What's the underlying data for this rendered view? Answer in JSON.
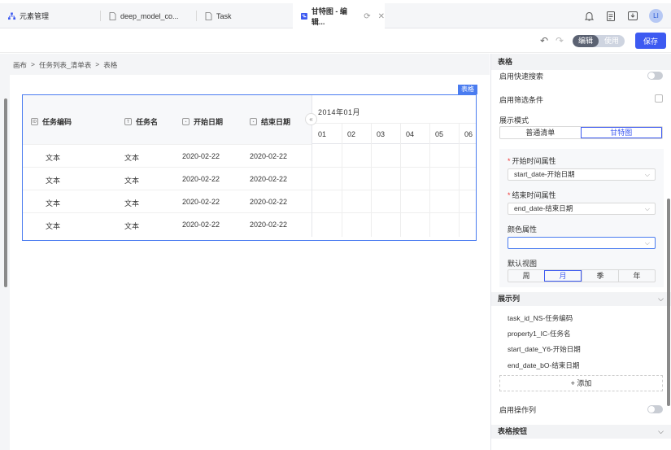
{
  "tabs": [
    {
      "label": "元素管理",
      "icon": "sitemap-icon",
      "color": "#3d5af1"
    },
    {
      "label": "deep_model_co...",
      "icon": "file-icon"
    },
    {
      "label": "Task",
      "icon": "file-icon"
    },
    {
      "label": "甘特图 - 编辑...",
      "icon": "gantt-icon",
      "color": "#3d5af1",
      "active": true
    }
  ],
  "user": {
    "initials": "LI"
  },
  "toolbar": {
    "undo": "↶",
    "redo": "↷",
    "mode_edit": "编辑",
    "mode_use": "使用",
    "save": "保存"
  },
  "breadcrumb": [
    "画布",
    ">",
    "任务列表_清单表",
    ">",
    "表格"
  ],
  "table": {
    "tag": "表格",
    "headers": [
      "任务编码",
      "任务名",
      "开始日期",
      "结束日期"
    ],
    "rows": [
      [
        "文本",
        "文本",
        "2020-02-22",
        "2020-02-22"
      ],
      [
        "文本",
        "文本",
        "2020-02-22",
        "2020-02-22"
      ],
      [
        "文本",
        "文本",
        "2020-02-22",
        "2020-02-22"
      ],
      [
        "文本",
        "文本",
        "2020-02-22",
        "2020-02-22"
      ]
    ],
    "gantt_month": "2014年01月",
    "gantt_days": [
      "01",
      "02",
      "03",
      "04",
      "05",
      "06"
    ]
  },
  "panel": {
    "title": "表格",
    "quick_search": "启用快速搜索",
    "filter": "启用筛选条件",
    "display_mode": "展示模式",
    "mode_options": [
      "普通清单",
      "甘特图"
    ],
    "start_attr_label": "开始时间属性",
    "start_attr_value": "start_date-开始日期",
    "end_attr_label": "结束时间属性",
    "end_attr_value": "end_date-结束日期",
    "color_attr_label": "颜色属性",
    "color_attr_value": "",
    "default_view_label": "默认视图",
    "view_options": [
      "周",
      "月",
      "季",
      "年"
    ],
    "columns_title": "展示列",
    "columns": [
      "task_id_NS-任务编码",
      "property1_IC-任务名",
      "start_date_Y6-开始日期",
      "end_date_bO-结束日期"
    ],
    "add_label": "+ 添加",
    "enable_action_col": "启用操作列",
    "table_buttons": "表格按钮"
  }
}
